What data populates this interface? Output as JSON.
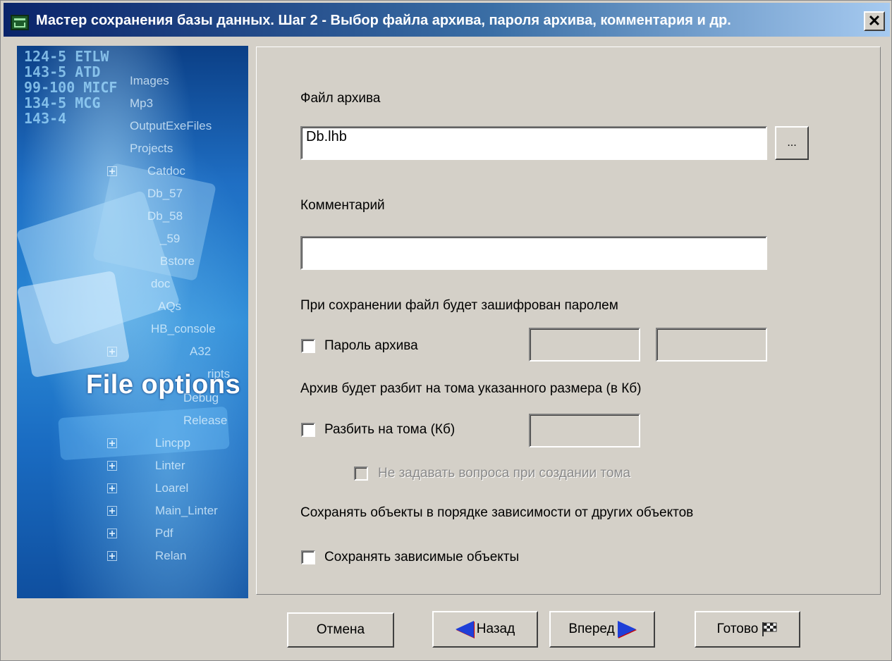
{
  "window": {
    "title": "Мастер сохранения базы данных. Шаг 2 - Выбор файла архива, пароля архива, комментария и др.",
    "close_label": "✕"
  },
  "side_image": {
    "caption": "File options",
    "code_text": "124-5 ETLW\n143-5 ATD\n99-100 MICF\n134-5 MCG\n143-4",
    "tree_items": [
      "Images",
      "Mp3",
      "OutputExeFiles",
      "Projects",
      "Catdoc",
      "Db_57",
      "Db_58",
      "_59",
      "Bstore",
      "doc",
      "AQs",
      "HB_console",
      "A32",
      "ripts",
      "Debug",
      "Release",
      "Lincpp",
      "Linter",
      "Loarel",
      "Main_Linter",
      "Pdf",
      "Relan"
    ]
  },
  "form": {
    "archive_file_label": "Файл архива",
    "archive_file_value": "Db.lhb",
    "browse_label": "...",
    "comment_label": "Комментарий",
    "comment_value": "",
    "encrypt_note": "При сохранении файл будет зашифрован паролем",
    "password_checkbox_label": "Пароль архива",
    "password_checked": false,
    "volumes_note": "Архив будет разбит на тома указанного размера (в Кб)",
    "split_checkbox_label": "Разбить на тома (Кб)",
    "split_checked": false,
    "no_ask_checkbox_label": "Не задавать вопроса при создании тома",
    "dependency_note": "Сохранять объекты в порядке зависимости от других объектов",
    "dependent_checkbox_label": "Сохранять зависимые объекты",
    "dependent_checked": false
  },
  "buttons": {
    "cancel": "Отмена",
    "back": "Назад",
    "next": "Вперед",
    "finish": "Готово"
  },
  "colors": {
    "titlebar_start": "#0a246a",
    "titlebar_end": "#a6caf0",
    "dialog_bg": "#d4d0c8",
    "arrow_blue": "#1e3fd8"
  }
}
